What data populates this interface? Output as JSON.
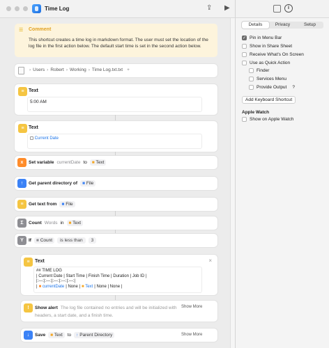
{
  "window": {
    "title": "Time Log"
  },
  "comment": {
    "label": "Comment",
    "text": "This shortcut creates a time log in markdown format. The user must set the location of the log file in the first action below. The default start time is set in the second action below."
  },
  "file": {
    "path": [
      "Users",
      "Robert",
      "Working",
      "Time Log.txt.txt"
    ],
    "sep": "›",
    "add": "+"
  },
  "text1": {
    "label": "Text",
    "value": "5:00 AM"
  },
  "text2": {
    "label": "Text",
    "value": "Current Date"
  },
  "setvar": {
    "label": "Set variable",
    "var": "currentDate",
    "to": "to",
    "value": "Text"
  },
  "parent": {
    "label": "Get parent directory of",
    "value": "File"
  },
  "gettext": {
    "label": "Get text from",
    "value": "File"
  },
  "count": {
    "label": "Count",
    "unit": "Words",
    "in": "in",
    "value": "Text"
  },
  "ifblock": {
    "label": "If",
    "var": "Count",
    "op": "is less than",
    "num": "3"
  },
  "text3": {
    "label": "Text",
    "close": "×",
    "lines": [
      "## TIME LOG",
      "| Current Date | Start Time | Finish Time | Duration | Job ID |",
      "|:---:|:---:|:---:|:---:|:---:|"
    ],
    "line4_sep1": "|",
    "line4_var1": "currentDate",
    "line4_mid": "| None |",
    "line4_var2": "Text",
    "line4_end": "| None | None |"
  },
  "alert": {
    "label": "Show alert",
    "text": "The log file contained no entries and will be initialized with headers, a start date, and a finish time.",
    "more": "Show More"
  },
  "save": {
    "label": "Save",
    "value": "Text",
    "to": "to",
    "dest": "Parent Directory",
    "more": "Show More"
  },
  "sidebar": {
    "tabs": [
      "Details",
      "Privacy",
      "Setup"
    ],
    "options": [
      {
        "label": "Pin in Menu Bar",
        "checked": true
      },
      {
        "label": "Show in Share Sheet",
        "checked": false
      },
      {
        "label": "Receive What's On Screen",
        "checked": false
      },
      {
        "label": "Use as Quick Action",
        "checked": false
      }
    ],
    "sub_options": [
      {
        "label": "Finder",
        "checked": false
      },
      {
        "label": "Services Menu",
        "checked": false
      },
      {
        "label": "Provide Output",
        "checked": false,
        "help": "?"
      }
    ],
    "shortcut_button": "Add Keyboard Shortcut",
    "watch_header": "Apple Watch",
    "watch_option": {
      "label": "Show on Apple Watch",
      "checked": false
    }
  }
}
